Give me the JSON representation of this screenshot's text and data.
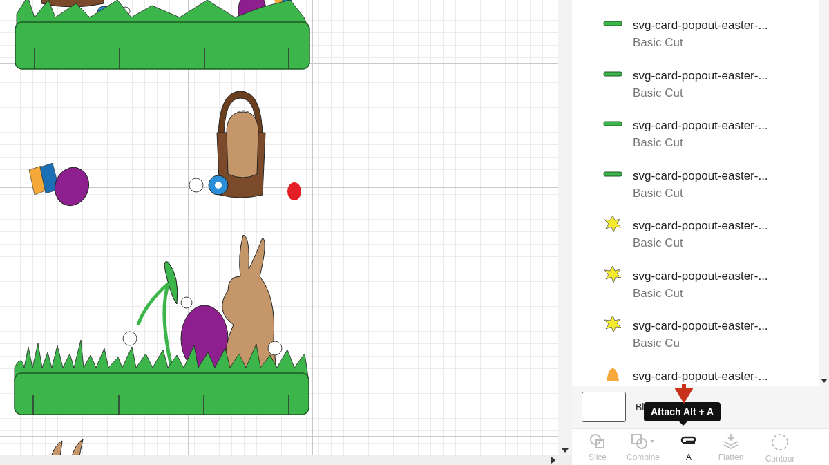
{
  "layers": [
    {
      "name": "svg-card-popout-easter-...",
      "operation": "Basic Cut",
      "kind": "ruler"
    },
    {
      "name": "svg-card-popout-easter-...",
      "operation": "Basic Cut",
      "kind": "ruler"
    },
    {
      "name": "svg-card-popout-easter-...",
      "operation": "Basic Cut",
      "kind": "ruler"
    },
    {
      "name": "svg-card-popout-easter-...",
      "operation": "Basic Cut",
      "kind": "ruler"
    },
    {
      "name": "svg-card-popout-easter-...",
      "operation": "Basic Cut",
      "kind": "splat"
    },
    {
      "name": "svg-card-popout-easter-...",
      "operation": "Basic Cut",
      "kind": "splat"
    },
    {
      "name": "svg-card-popout-easter-...",
      "operation": "Basic Cu",
      "kind": "splat"
    },
    {
      "name": "svg-card-popout-easter-...",
      "kind": "egg"
    }
  ],
  "blank_layer": {
    "label": "Bl"
  },
  "tooltip": "Attach Alt + A",
  "tools": [
    {
      "label": "Slice",
      "kind": "slice",
      "disabled": true
    },
    {
      "label": "Combine",
      "kind": "combine",
      "disabled": true
    },
    {
      "label": "A",
      "kind": "attach",
      "disabled": false
    },
    {
      "label": "Flatten",
      "kind": "flatten",
      "disabled": true
    },
    {
      "label": "Contour",
      "kind": "contour",
      "disabled": true
    }
  ]
}
